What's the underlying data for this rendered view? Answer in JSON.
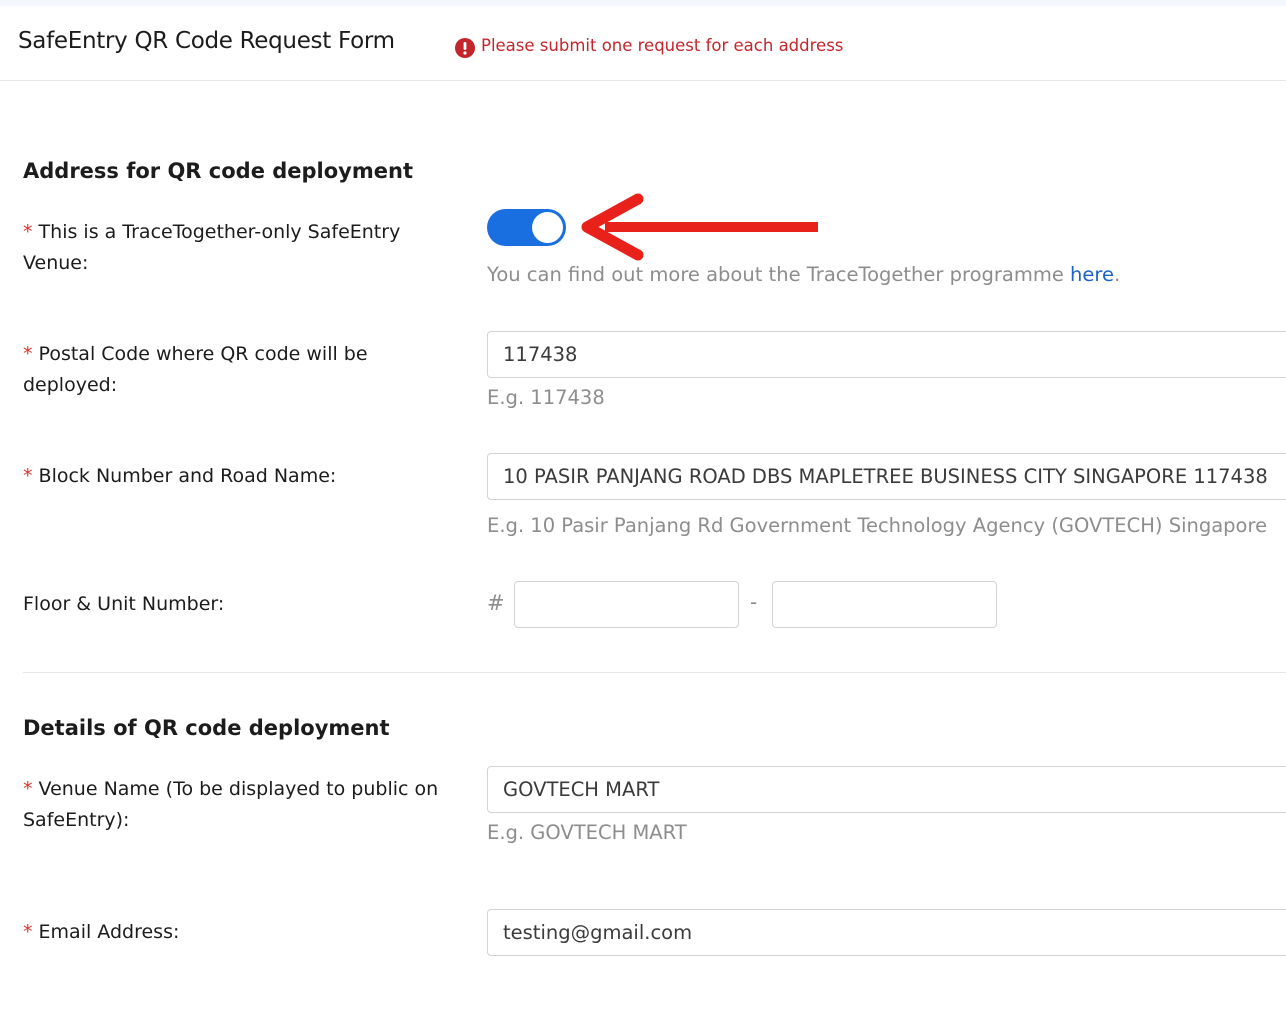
{
  "header": {
    "title": "SafeEntry QR Code Request Form",
    "notice": "Please submit one request for each address",
    "notice_icon": "exclamation-circle-icon",
    "notice_color": "#c4252b"
  },
  "sections": {
    "address_heading": "Address for QR code deployment",
    "details_heading": "Details of QR code deployment"
  },
  "fields": {
    "required_marker": "*",
    "tt_only": {
      "label": "This is a TraceTogether-only SafeEntry Venue:",
      "toggle_on": true,
      "toggle_color": "#1a6fe0",
      "help_prefix": "You can find out more about the TraceTogether programme ",
      "help_link": "here",
      "help_suffix": "."
    },
    "postal_code": {
      "label": "Postal Code where QR code will be deployed:",
      "value": "117438",
      "hint": "E.g. 117438"
    },
    "block_road": {
      "label": "Block Number and Road Name:",
      "value": "10 PASIR PANJANG ROAD DBS MAPLETREE BUSINESS CITY SINGAPORE 117438",
      "hint": "E.g. 10 Pasir Panjang Rd Government Technology Agency (GOVTECH) Singapore"
    },
    "floor_unit": {
      "label": "Floor & Unit Number:",
      "prefix": "#",
      "separator": "-",
      "floor_value": "",
      "unit_value": ""
    },
    "venue_name": {
      "label": "Venue Name (To be displayed to public on SafeEntry):",
      "value": "GOVTECH MART",
      "hint": "E.g. GOVTECH MART"
    },
    "email": {
      "label": "Email Address:",
      "value": "testing@gmail.com"
    }
  },
  "annotation": {
    "arrow_color": "#e8211b",
    "arrow_icon": "red-arrow-left-icon"
  }
}
